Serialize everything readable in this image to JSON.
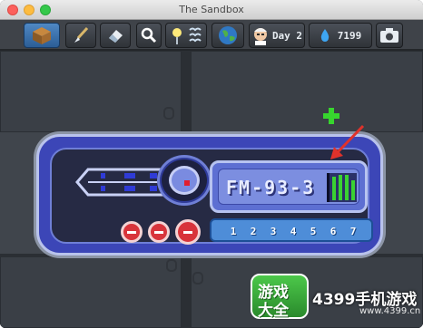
{
  "window": {
    "title": "The Sandbox"
  },
  "toolbar": {
    "day_label": "Day 2",
    "mana_value": "7199"
  },
  "radio": {
    "frequency": "FM-93-3",
    "presets": [
      "1",
      "2",
      "3",
      "4",
      "5",
      "6",
      "7"
    ]
  },
  "watermark": {
    "badge_top": "游戏",
    "badge_bottom": "大全",
    "brand": "4399手机游戏",
    "url": "www.4399.cn"
  },
  "colors": {
    "accent": "#4f88c4",
    "radio_body": "#3c46b7",
    "signal": "#3ad232",
    "knob": "#d8343b",
    "annotation_arrow": "#e0322b"
  },
  "icons": [
    "dirt-block-icon",
    "brush-icon",
    "eraser-icon",
    "magnifier-icon",
    "weather-icon",
    "globe-icon",
    "scientist-avatar-icon",
    "water-drop-icon",
    "camera-icon"
  ]
}
